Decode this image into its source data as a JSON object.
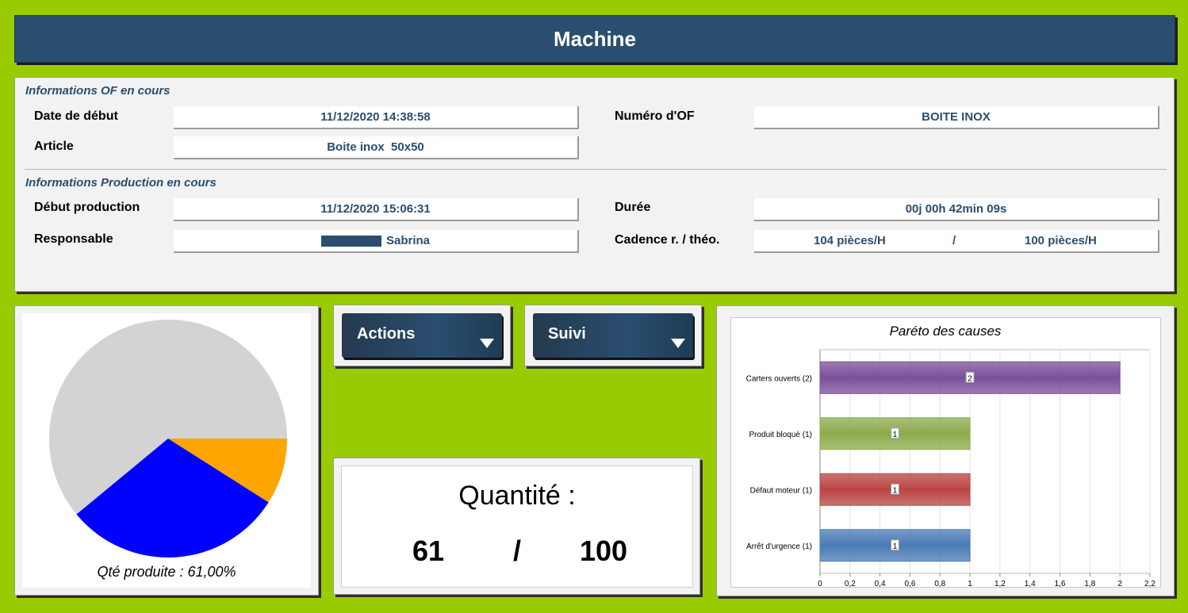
{
  "header": {
    "title": "Machine"
  },
  "of_info": {
    "section_title": "Informations OF en cours",
    "date_debut_label": "Date de début",
    "date_debut_value": "11/12/2020 14:38:58",
    "numero_of_label": "Numéro d'OF",
    "numero_of_value": "BOITE INOX",
    "article_label": "Article",
    "article_value": "Boite inox  50x50"
  },
  "production_info": {
    "section_title": "Informations Production en cours",
    "debut_label": "Début production",
    "debut_value": "11/12/2020 15:06:31",
    "duree_label": "Durée",
    "duree_value": "00j 00h 42min 09s",
    "responsable_label": "Responsable",
    "responsable_value": "Sabrina",
    "cadence_label": "Cadence r. / théo.",
    "cadence_real": "104 pièces/H",
    "cadence_separator": "/",
    "cadence_theo": "100 pièces/H"
  },
  "pie": {
    "caption": "Qté produite : 61,00%"
  },
  "buttons": {
    "actions_label": "Actions",
    "suivi_label": "Suivi"
  },
  "quantity": {
    "title": "Quantité :",
    "produced": "61",
    "separator": "/",
    "target": "100"
  },
  "colors": {
    "brand": "#2a4e6f",
    "background": "#99cc00"
  },
  "chart_data": [
    {
      "type": "pie",
      "slices": [
        {
          "value": 61,
          "color": "#d3d3d3"
        },
        {
          "value": 30,
          "color": "#0000ff"
        },
        {
          "value": 9,
          "color": "#ffa500"
        }
      ]
    },
    {
      "type": "bar",
      "orientation": "horizontal",
      "title": "Paréto des causes",
      "categories": [
        "Carters ouverts (2)",
        "Produit bloqué (1)",
        "Défaut moteur (1)",
        "Arrêt d'urgence (1)"
      ],
      "values": [
        2,
        1,
        1,
        1
      ],
      "colors": [
        "#7a4f9a",
        "#8cab4a",
        "#bb4444",
        "#4a7ab5"
      ],
      "data_labels": [
        "2",
        "1",
        "1",
        "1"
      ],
      "xlim": [
        0,
        2.2
      ],
      "xticks": [
        "0",
        "0,2",
        "0,4",
        "0,6",
        "0,8",
        "1",
        "1,2",
        "1,4",
        "1,6",
        "1,8",
        "2",
        "2,2"
      ],
      "grid": true
    }
  ]
}
